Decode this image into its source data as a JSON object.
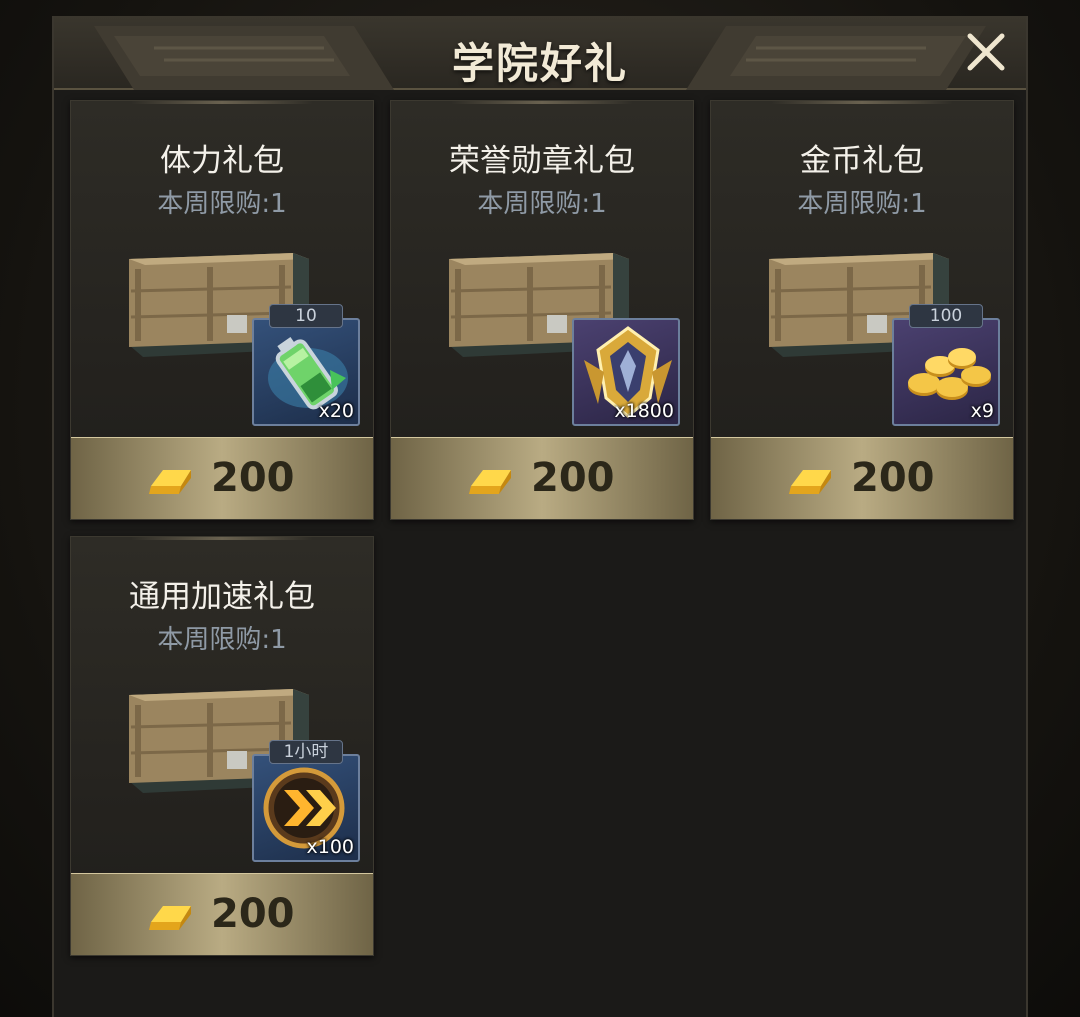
{
  "header": {
    "title": "学院好礼"
  },
  "packs": [
    {
      "name": "体力礼包",
      "limit": "本周限购:1",
      "item_icon": "stamina-battery-icon",
      "item_tag": "10",
      "item_qty": "x20",
      "price": "200"
    },
    {
      "name": "荣誉勋章礼包",
      "limit": "本周限购:1",
      "item_icon": "honor-medal-icon",
      "item_tag": "",
      "item_qty": "x1800",
      "price": "200"
    },
    {
      "name": "金币礼包",
      "limit": "本周限购:1",
      "item_icon": "gold-coins-icon",
      "item_tag": "100",
      "item_qty": "x9",
      "price": "200"
    },
    {
      "name": "通用加速礼包",
      "limit": "本周限购:1",
      "item_icon": "speedup-icon",
      "item_tag": "1小时",
      "item_qty": "x100",
      "price": "200"
    }
  ],
  "colors": {
    "accent_gold": "#b9ab83",
    "panel_bg": "#1b1a18"
  },
  "icons": {
    "close": "close-icon",
    "currency": "gold-bar-icon"
  }
}
